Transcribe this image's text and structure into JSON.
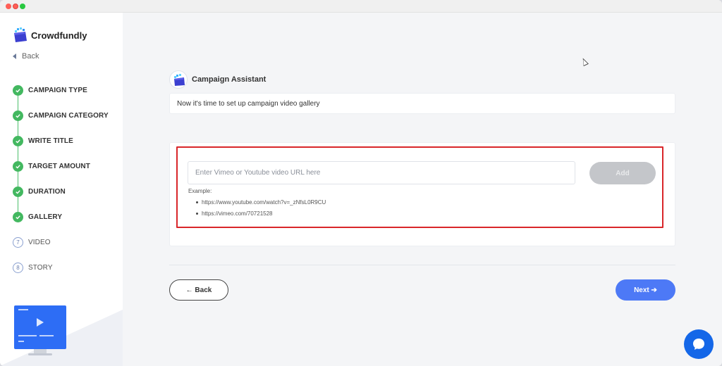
{
  "app": {
    "brand_name": "Crowdfundly"
  },
  "sidebar": {
    "back_label": "Back",
    "steps": [
      {
        "label": "CAMPAIGN TYPE",
        "status": "done"
      },
      {
        "label": "CAMPAIGN CATEGORY",
        "status": "done"
      },
      {
        "label": "WRITE TITLE",
        "status": "done"
      },
      {
        "label": "TARGET AMOUNT",
        "status": "done"
      },
      {
        "label": "DURATION",
        "status": "done"
      },
      {
        "label": "GALLERY",
        "status": "done"
      },
      {
        "label": "VIDEO",
        "status": "current",
        "number": "7"
      },
      {
        "label": "STORY",
        "status": "pending",
        "number": "8"
      }
    ]
  },
  "assistant": {
    "name": "Campaign Assistant",
    "message": "Now it's time to set up campaign video gallery"
  },
  "video_form": {
    "url_placeholder": "Enter Vimeo or Youtube video URL here",
    "url_value": "",
    "add_label": "Add",
    "example_label": "Example:",
    "examples": [
      "https://www.youtube.com/watch?v=_zNfsL0R9CU",
      "https://vimeo.com/70721528"
    ]
  },
  "navigation": {
    "back_label": "← Back",
    "next_label": "Next ➔"
  },
  "colors": {
    "accent": "#4d79f6",
    "done": "#43b860",
    "highlight": "#d9262a",
    "chat": "#1467e8"
  }
}
